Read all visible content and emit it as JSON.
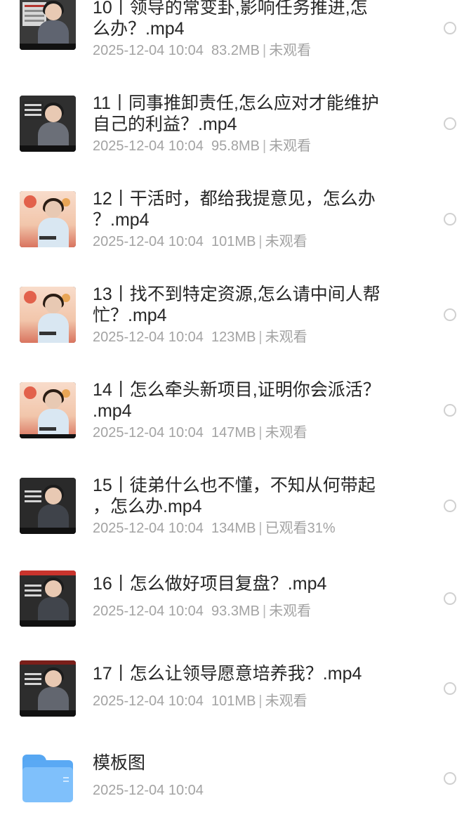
{
  "items": [
    {
      "title": "10丨领导的常变卦,影响任务推进,怎\n么办？.mp4",
      "date": "2025-12-04 10:04",
      "size": "83.2MB",
      "status": "未观看"
    },
    {
      "title": "11丨同事推卸责任,怎么应对才能维护\n自己的利益？.mp4",
      "date": "2025-12-04 10:04",
      "size": "95.8MB",
      "status": "未观看"
    },
    {
      "title": "12丨干活时，都给我提意见，怎么办\n？.mp4",
      "date": "2025-12-04 10:04",
      "size": "101MB",
      "status": "未观看"
    },
    {
      "title": "13丨找不到特定资源,怎么请中间人帮\n忙？.mp4",
      "date": "2025-12-04 10:04",
      "size": "123MB",
      "status": "未观看"
    },
    {
      "title": "14丨怎么牵头新项目,证明你会派活？\n.mp4",
      "date": "2025-12-04 10:04",
      "size": "147MB",
      "status": "未观看"
    },
    {
      "title": "15丨徒弟什么也不懂，不知从何带起\n，怎么办.mp4",
      "date": "2025-12-04 10:04",
      "size": "134MB",
      "status": "已观看31%"
    },
    {
      "title": "16丨怎么做好项目复盘？.mp4",
      "date": "2025-12-04 10:04",
      "size": "93.3MB",
      "status": "未观看"
    },
    {
      "title": "17丨怎么让领导愿意培养我？.mp4",
      "date": "2025-12-04 10:04",
      "size": "101MB",
      "status": "未观看"
    }
  ],
  "folder": {
    "name": "模板图",
    "date": "2025-12-04 10:04"
  }
}
